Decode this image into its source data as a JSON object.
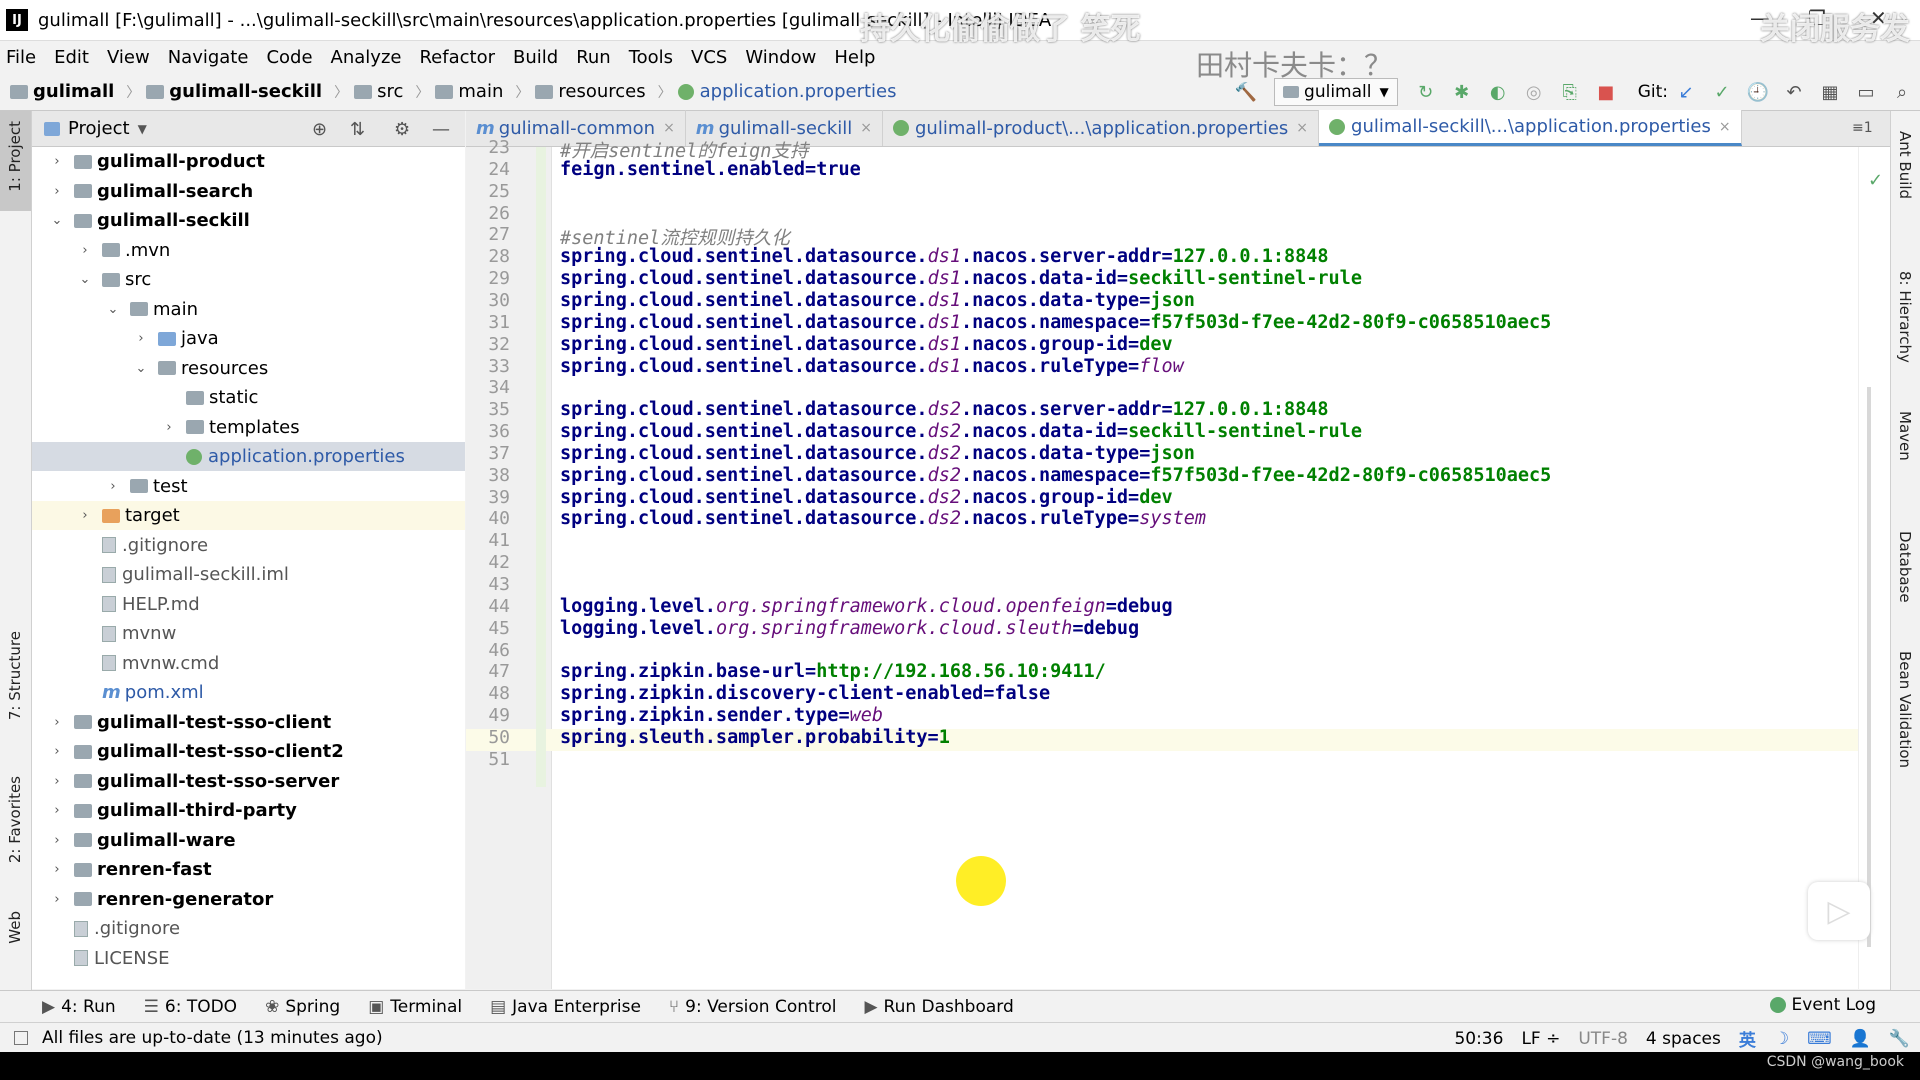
{
  "window": {
    "title": "gulimall [F:\\gulimall] - ...\\gulimall-seckill\\src\\main\\resources\\application.properties [gulimall-seckill] - IntelliJ IDEA",
    "logo": "IJ",
    "minimize": "—",
    "maximize": "❐",
    "close": "✕"
  },
  "overlay": {
    "danmaku1": "持久化偷偷做了 笑死",
    "danmaku2": "关闭服务发",
    "danmaku3": "田村卡夫卡：？",
    "watermark": "CSDN @wang_book"
  },
  "menu": [
    "File",
    "Edit",
    "View",
    "Navigate",
    "Code",
    "Analyze",
    "Refactor",
    "Build",
    "Run",
    "Tools",
    "VCS",
    "Window",
    "Help"
  ],
  "breadcrumb": [
    "gulimall",
    "gulimall-seckill",
    "src",
    "main",
    "resources",
    "application.properties"
  ],
  "toolbar": {
    "run_config": "gulimall",
    "git_label": "Git:"
  },
  "left_strip": {
    "project": "1: Project",
    "structure": "7: Structure",
    "favorites": "2: Favorites",
    "web": "Web"
  },
  "right_strip": {
    "ant": "Ant Build",
    "hierarchy": "8: Hierarchy",
    "maven": "Maven",
    "database": "Database",
    "bean": "Bean Validation"
  },
  "project_panel": {
    "title": "Project",
    "tree": [
      {
        "label": "gulimall-product",
        "depth": 0,
        "arrow": "›",
        "kind": "module"
      },
      {
        "label": "gulimall-search",
        "depth": 0,
        "arrow": "›",
        "kind": "module"
      },
      {
        "label": "gulimall-seckill",
        "depth": 0,
        "arrow": "⌄",
        "kind": "module"
      },
      {
        "label": ".mvn",
        "depth": 1,
        "arrow": "›",
        "kind": "folder"
      },
      {
        "label": "src",
        "depth": 1,
        "arrow": "⌄",
        "kind": "folder"
      },
      {
        "label": "main",
        "depth": 2,
        "arrow": "⌄",
        "kind": "folder"
      },
      {
        "label": "java",
        "depth": 3,
        "arrow": "›",
        "kind": "folder-blue"
      },
      {
        "label": "resources",
        "depth": 3,
        "arrow": "⌄",
        "kind": "folder"
      },
      {
        "label": "static",
        "depth": 4,
        "arrow": "",
        "kind": "folder"
      },
      {
        "label": "templates",
        "depth": 4,
        "arrow": "›",
        "kind": "folder"
      },
      {
        "label": "application.properties",
        "depth": 4,
        "arrow": "",
        "kind": "props",
        "selected": true
      },
      {
        "label": "test",
        "depth": 2,
        "arrow": "›",
        "kind": "folder"
      },
      {
        "label": "target",
        "depth": 1,
        "arrow": "›",
        "kind": "folder-orange",
        "highlight": true
      },
      {
        "label": ".gitignore",
        "depth": 1,
        "arrow": "",
        "kind": "file"
      },
      {
        "label": "gulimall-seckill.iml",
        "depth": 1,
        "arrow": "",
        "kind": "file"
      },
      {
        "label": "HELP.md",
        "depth": 1,
        "arrow": "",
        "kind": "file"
      },
      {
        "label": "mvnw",
        "depth": 1,
        "arrow": "",
        "kind": "file"
      },
      {
        "label": "mvnw.cmd",
        "depth": 1,
        "arrow": "",
        "kind": "file"
      },
      {
        "label": "pom.xml",
        "depth": 1,
        "arrow": "",
        "kind": "maven"
      },
      {
        "label": "gulimall-test-sso-client",
        "depth": 0,
        "arrow": "›",
        "kind": "module"
      },
      {
        "label": "gulimall-test-sso-client2",
        "depth": 0,
        "arrow": "›",
        "kind": "module"
      },
      {
        "label": "gulimall-test-sso-server",
        "depth": 0,
        "arrow": "›",
        "kind": "module"
      },
      {
        "label": "gulimall-third-party",
        "depth": 0,
        "arrow": "›",
        "kind": "module"
      },
      {
        "label": "gulimall-ware",
        "depth": 0,
        "arrow": "›",
        "kind": "module"
      },
      {
        "label": "renren-fast",
        "depth": 0,
        "arrow": "›",
        "kind": "module"
      },
      {
        "label": "renren-generator",
        "depth": 0,
        "arrow": "›",
        "kind": "module"
      },
      {
        "label": ".gitignore",
        "depth": 0,
        "arrow": "",
        "kind": "file"
      },
      {
        "label": "LICENSE",
        "depth": 0,
        "arrow": "",
        "kind": "file"
      }
    ]
  },
  "tabs": [
    {
      "label": "gulimall-common",
      "kind": "maven"
    },
    {
      "label": "gulimall-seckill",
      "kind": "maven"
    },
    {
      "label": "gulimall-product\\...\\application.properties",
      "kind": "props"
    },
    {
      "label": "gulimall-seckill\\...\\application.properties",
      "kind": "props",
      "active": true
    }
  ],
  "editor": {
    "lines": [
      {
        "n": "23",
        "parts": [
          [
            "c",
            "#开启sentinel的feign支持"
          ]
        ]
      },
      {
        "n": "24",
        "parts": [
          [
            "k",
            "feign.sentinel.enabled="
          ],
          [
            "k",
            "true"
          ]
        ]
      },
      {
        "n": "25",
        "parts": []
      },
      {
        "n": "26",
        "parts": []
      },
      {
        "n": "27",
        "parts": [
          [
            "c",
            "#sentinel流控规则持久化"
          ]
        ]
      },
      {
        "n": "28",
        "parts": [
          [
            "k",
            "spring.cloud.sentinel.datasource."
          ],
          [
            "i",
            "ds1"
          ],
          [
            "k",
            ".nacos.server-addr="
          ],
          [
            "v",
            "127.0.0.1:8848"
          ]
        ]
      },
      {
        "n": "29",
        "parts": [
          [
            "k",
            "spring.cloud.sentinel.datasource."
          ],
          [
            "i",
            "ds1"
          ],
          [
            "k",
            ".nacos.data-id="
          ],
          [
            "v",
            "seckill-sentinel-rule"
          ]
        ]
      },
      {
        "n": "30",
        "parts": [
          [
            "k",
            "spring.cloud.sentinel.datasource."
          ],
          [
            "i",
            "ds1"
          ],
          [
            "k",
            ".nacos.data-type="
          ],
          [
            "v",
            "json"
          ]
        ]
      },
      {
        "n": "31",
        "parts": [
          [
            "k",
            "spring.cloud.sentinel.datasource."
          ],
          [
            "i",
            "ds1"
          ],
          [
            "k",
            ".nacos.namespace="
          ],
          [
            "v",
            "f57f503d-f7ee-42d2-80f9-c0658510aec5"
          ]
        ]
      },
      {
        "n": "32",
        "parts": [
          [
            "k",
            "spring.cloud.sentinel.datasource."
          ],
          [
            "i",
            "ds1"
          ],
          [
            "k",
            ".nacos.group-id="
          ],
          [
            "v",
            "dev"
          ]
        ]
      },
      {
        "n": "33",
        "parts": [
          [
            "k",
            "spring.cloud.sentinel.datasource."
          ],
          [
            "i",
            "ds1"
          ],
          [
            "k",
            ".nacos.ruleType="
          ],
          [
            "i",
            "flow"
          ]
        ]
      },
      {
        "n": "34",
        "parts": []
      },
      {
        "n": "35",
        "parts": [
          [
            "k",
            "spring.cloud.sentinel.datasource."
          ],
          [
            "i",
            "ds2"
          ],
          [
            "k",
            ".nacos.server-addr="
          ],
          [
            "v",
            "127.0.0.1:8848"
          ]
        ]
      },
      {
        "n": "36",
        "parts": [
          [
            "k",
            "spring.cloud.sentinel.datasource."
          ],
          [
            "i",
            "ds2"
          ],
          [
            "k",
            ".nacos.data-id="
          ],
          [
            "v",
            "seckill-sentinel-rule"
          ]
        ]
      },
      {
        "n": "37",
        "parts": [
          [
            "k",
            "spring.cloud.sentinel.datasource."
          ],
          [
            "i",
            "ds2"
          ],
          [
            "k",
            ".nacos.data-type="
          ],
          [
            "v",
            "json"
          ]
        ]
      },
      {
        "n": "38",
        "parts": [
          [
            "k",
            "spring.cloud.sentinel.datasource."
          ],
          [
            "i",
            "ds2"
          ],
          [
            "k",
            ".nacos.namespace="
          ],
          [
            "v",
            "f57f503d-f7ee-42d2-80f9-c0658510aec5"
          ]
        ]
      },
      {
        "n": "39",
        "parts": [
          [
            "k",
            "spring.cloud.sentinel.datasource."
          ],
          [
            "i",
            "ds2"
          ],
          [
            "k",
            ".nacos.group-id="
          ],
          [
            "v",
            "dev"
          ]
        ]
      },
      {
        "n": "40",
        "parts": [
          [
            "k",
            "spring.cloud.sentinel.datasource."
          ],
          [
            "i",
            "ds2"
          ],
          [
            "k",
            ".nacos.ruleType="
          ],
          [
            "i",
            "system"
          ]
        ]
      },
      {
        "n": "41",
        "parts": []
      },
      {
        "n": "42",
        "parts": []
      },
      {
        "n": "43",
        "parts": []
      },
      {
        "n": "44",
        "parts": [
          [
            "k",
            "logging.level."
          ],
          [
            "i",
            "org.springframework.cloud.openfeign"
          ],
          [
            "k",
            "=debug"
          ]
        ]
      },
      {
        "n": "45",
        "parts": [
          [
            "k",
            "logging.level."
          ],
          [
            "i",
            "org.springframework.cloud.sleuth"
          ],
          [
            "k",
            "=debug"
          ]
        ]
      },
      {
        "n": "46",
        "parts": []
      },
      {
        "n": "47",
        "parts": [
          [
            "k",
            "spring.zipkin.base-url="
          ],
          [
            "v",
            "http://192.168.56.10:9411/"
          ]
        ]
      },
      {
        "n": "48",
        "parts": [
          [
            "k",
            "spring.zipkin.discovery-client-enabled="
          ],
          [
            "k",
            "false"
          ]
        ]
      },
      {
        "n": "49",
        "parts": [
          [
            "k",
            "spring.zipkin.sender.type="
          ],
          [
            "i",
            "web"
          ]
        ]
      },
      {
        "n": "50",
        "parts": [
          [
            "k",
            "spring.sleuth.sampler.probability="
          ],
          [
            "v",
            "1"
          ]
        ]
      },
      {
        "n": "51",
        "parts": []
      }
    ]
  },
  "bottom_tools": [
    {
      "icon": "▶",
      "label": "4: Run"
    },
    {
      "icon": "☰",
      "label": "6: TODO"
    },
    {
      "icon": "❀",
      "label": "Spring"
    },
    {
      "icon": "▣",
      "label": "Terminal"
    },
    {
      "icon": "▤",
      "label": "Java Enterprise"
    },
    {
      "icon": "⑂",
      "label": "9: Version Control"
    },
    {
      "icon": "▶",
      "label": "Run Dashboard"
    }
  ],
  "event_log": "Event Log",
  "status": {
    "message": "All files are up-to-date (13 minutes ago)",
    "position": "50:36",
    "line_sep": "LF ÷",
    "encoding": "UTF-8",
    "indent": "4 spaces",
    "ime": "英"
  },
  "colors": {
    "accent": "#4a88c7",
    "keyword": "#000080",
    "value": "#008000",
    "italic": "#660e7a",
    "comment": "#808080"
  }
}
